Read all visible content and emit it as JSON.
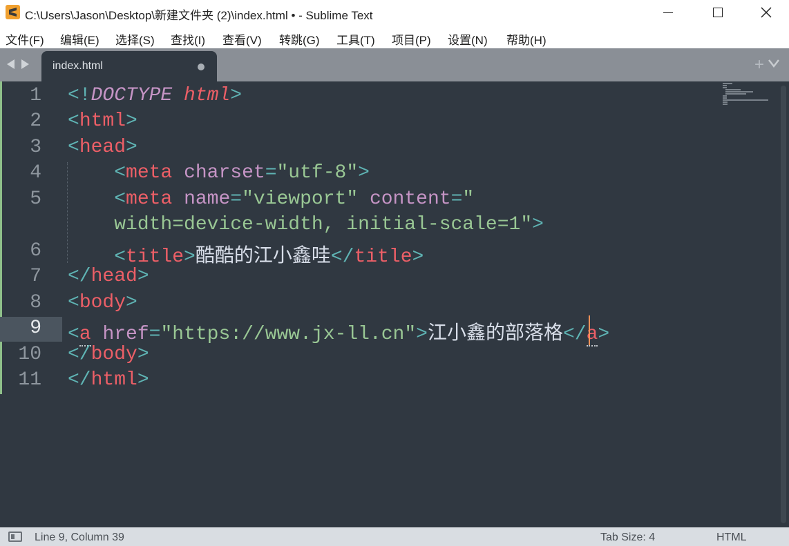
{
  "window": {
    "title": "C:\\Users\\Jason\\Desktop\\新建文件夹 (2)\\index.html • - Sublime Text",
    "minimize_glyph": "—",
    "maximize_glyph": "☐",
    "close_glyph": "✕"
  },
  "menu": [
    "文件(F)",
    "编辑(E)",
    "选择(S)",
    "查找(I)",
    "查看(V)",
    "转跳(G)",
    "工具(T)",
    "项目(P)",
    "设置(N)",
    "帮助(H)"
  ],
  "tabs": [
    {
      "label": "index.html",
      "modified": true,
      "active": true
    }
  ],
  "tabbar": {
    "add_glyph": "+"
  },
  "editor": {
    "line_numbers": [
      "1",
      "2",
      "3",
      "4",
      "5",
      "",
      "6",
      "7",
      "8",
      "9",
      "10",
      "11"
    ],
    "current_line": "9",
    "lines": {
      "l1": {
        "p1": "<!",
        "doctype": "DOCTYPE",
        "sp": " ",
        "html": "html",
        "p2": ">"
      },
      "l2": {
        "p1": "<",
        "tag": "html",
        "p2": ">"
      },
      "l3": {
        "p1": "<",
        "tag": "head",
        "p2": ">"
      },
      "l4": {
        "indent": "    ",
        "p1": "<",
        "tag": "meta",
        "sp": " ",
        "attr": "charset",
        "eq": "=",
        "val": "\"utf-8\"",
        "p2": ">"
      },
      "l5": {
        "indent": "    ",
        "p1": "<",
        "tag": "meta",
        "sp": " ",
        "attr1": "name",
        "eq1": "=",
        "val1": "\"viewport\"",
        "sp2": " ",
        "attr2": "content",
        "eq2": "=",
        "val2a": "\""
      },
      "l5b": {
        "indent": "    ",
        "val2b": "width=device-width, initial-scale=1\"",
        "p2": ">"
      },
      "l6": {
        "indent": "    ",
        "p1": "<",
        "tag": "title",
        "p2": ">",
        "text": "酷酷的江小鑫哇",
        "p3": "</",
        "tag2": "title",
        "p4": ">"
      },
      "l7": {
        "p1": "</",
        "tag": "head",
        "p2": ">"
      },
      "l8": {
        "p1": "<",
        "tag": "body",
        "p2": ">"
      },
      "l9": {
        "p1": "<",
        "tag": "a",
        "sp": " ",
        "attr": "href",
        "eq": "=",
        "val": "\"https://www.jx-ll.cn\"",
        "p2": ">",
        "text": "江小鑫的部落格",
        "p3": "</",
        "tag2": "a",
        "p4": ">"
      },
      "l10": {
        "p1": "</",
        "tag": "body",
        "p2": ">"
      },
      "l11": {
        "p1": "</",
        "tag": "html",
        "p2": ">"
      }
    }
  },
  "status": {
    "position": "Line 9, Column 39",
    "tab_size": "Tab Size: 4",
    "syntax": "HTML"
  },
  "colors": {
    "editor_bg": "#303841",
    "tag": "#ec5f67",
    "punctuation": "#5fb4b4",
    "attribute": "#c594c5",
    "string": "#99c794",
    "caret": "#f99157"
  }
}
